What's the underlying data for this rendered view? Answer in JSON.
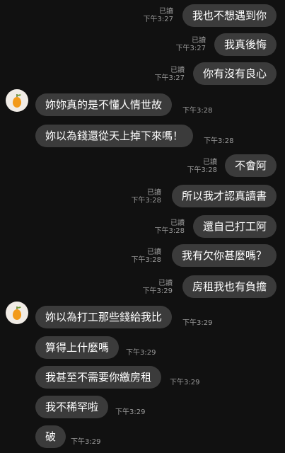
{
  "messages": [
    {
      "side": "out",
      "text": "我也不想遇到你",
      "read": "已讀",
      "time": "下午3:27"
    },
    {
      "side": "out",
      "text": "我真後悔",
      "read": "已讀",
      "time": "下午3:27"
    },
    {
      "side": "out",
      "text": "你有沒有良心",
      "read": "已讀",
      "time": "下午3:27"
    },
    {
      "side": "in",
      "avatar": true,
      "text": "妳妳真的是不懂人情世故",
      "time": "下午3:28"
    },
    {
      "side": "in",
      "text": "妳以為錢還從天上掉下來嗎！",
      "time": "下午3:28"
    },
    {
      "side": "out",
      "text": "不會阿",
      "read": "已讀",
      "time": "下午3:28"
    },
    {
      "side": "out",
      "text": "所以我才認真讀書",
      "read": "已讀",
      "time": "下午3:28"
    },
    {
      "side": "out",
      "text": "還自己打工阿",
      "read": "已讀",
      "time": "下午3:28"
    },
    {
      "side": "out",
      "text": "我有欠你甚麼嗎？",
      "read": "已讀",
      "time": "下午3:28"
    },
    {
      "side": "out",
      "text": "房租我也有負擔",
      "read": "已讀",
      "time": "下午3:29"
    },
    {
      "side": "in",
      "avatar": true,
      "text": "妳以為打工那些錢給我比",
      "time": "下午3:29"
    },
    {
      "side": "in",
      "text": "算得上什麼嗎",
      "time": "下午3:29"
    },
    {
      "side": "in",
      "text": "我甚至不需要你繳房租",
      "time": "下午3:29"
    },
    {
      "side": "in",
      "text": "我不稀罕啦",
      "time": "下午3:29"
    },
    {
      "side": "in",
      "text": "破",
      "time": "下午3:29"
    }
  ],
  "colors": {
    "background": "#111111",
    "bubble": "#3b3b3b",
    "meta": "#9a9a9a",
    "avatar_bg": "#f1ece6",
    "avatar_fruit": "#f29a1a"
  },
  "icons": {
    "avatar": "orange-fruit-icon"
  }
}
